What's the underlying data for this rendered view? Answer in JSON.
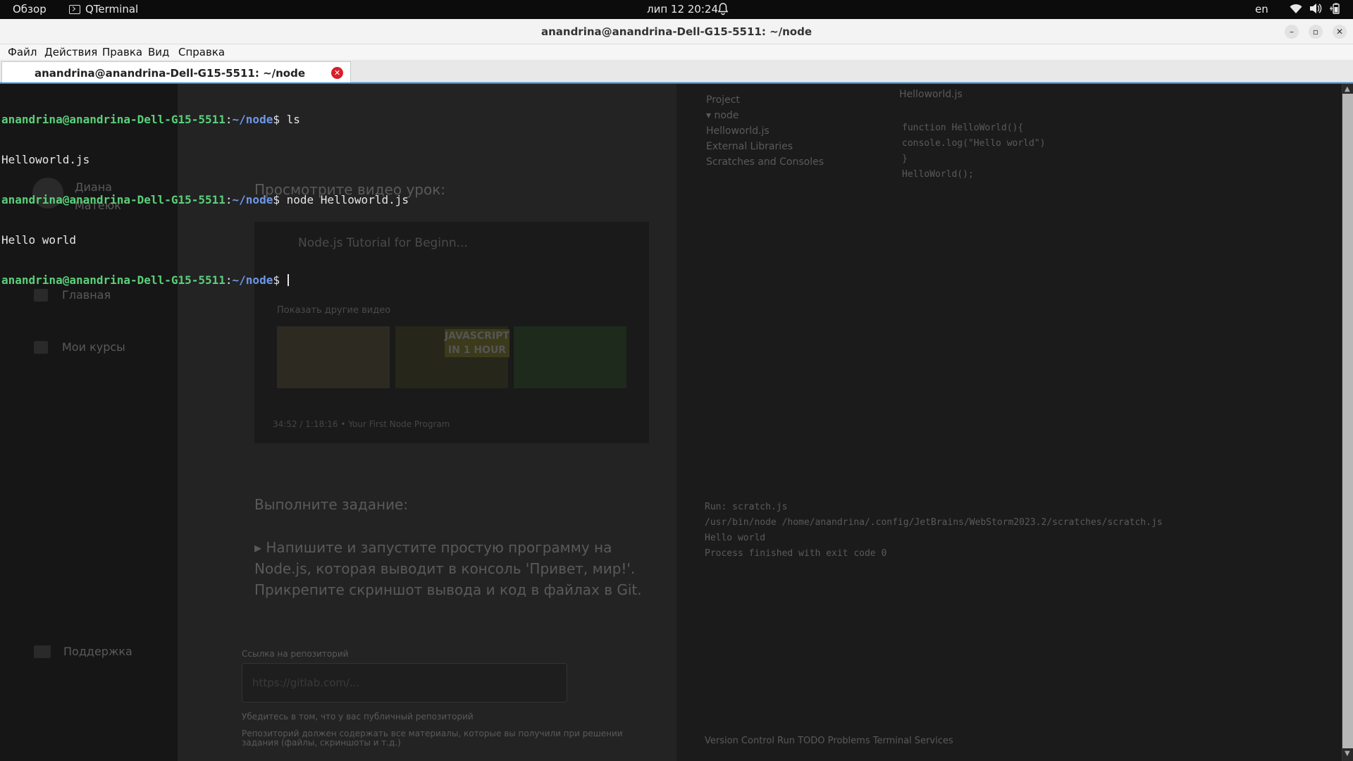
{
  "topbar": {
    "overview": "Обзор",
    "app_name": "QTerminal",
    "clock": "лип 12  20:24",
    "lang": "en"
  },
  "window": {
    "title": "anandrina@anandrina-Dell-G15-5511: ~/node"
  },
  "menu": [
    "Файл",
    "Действия",
    "Правка",
    "Вид",
    "Справка"
  ],
  "tab": {
    "label": "anandrina@anandrina-Dell-G15-5511: ~/node"
  },
  "terminal": {
    "lines": [
      {
        "kind": "prompt",
        "user": "anandrina@anandrina-Dell-G15-5511",
        "path": "~/node",
        "cmd": "ls"
      },
      {
        "kind": "output",
        "text": "Helloworld.js"
      },
      {
        "kind": "prompt",
        "user": "anandrina@anandrina-Dell-G15-5511",
        "path": "~/node",
        "cmd": "node Helloworld.js"
      },
      {
        "kind": "output",
        "text": "Hello world"
      },
      {
        "kind": "prompt",
        "user": "anandrina@anandrina-Dell-G15-5511",
        "path": "~/node",
        "cmd": ""
      }
    ]
  },
  "background": {
    "user_name_1": "Диана",
    "user_name_2": "Матеюк",
    "nav_home": "Главная",
    "nav_courses": "Мои курсы",
    "nav_support": "Поддержка",
    "heading_video": "Просмотрите видео урок:",
    "video_title": "Node.js Tutorial for Beginn...",
    "video_more": "Показать другие видео",
    "video_js_thumb": "JAVASCRIPT IN 1 HOUR",
    "video_bar": "34:52 / 1:18:16 • Your First Node Program",
    "heading_task": "Выполните задание:",
    "task_text": "▸ Напишите и запустите простую программу на Node.js, которая выводит в консоль 'Привет, мир!'. Прикрепите скриншот вывода и код в файлах в Git.",
    "repo_label": "Ссылка на репозиторий",
    "repo_placeholder": "https://gitlab.com/...",
    "repo_hint": "Убедитесь в том, что у вас публичный репозиторий",
    "repo_note": "Репозиторий должен содержать все материалы, которые вы получили при решении задания (файлы, скриншоты и т.д.)",
    "ide_project": [
      "Project",
      "▾ node",
      "   Helloworld.js",
      "  External Libraries",
      "  Scratches and Consoles"
    ],
    "ide_tab": "Helloworld.js",
    "ide_code": [
      "function HelloWorld(){",
      "    console.log(\"Hello world\")",
      "}",
      "",
      "HelloWorld();"
    ],
    "ide_run": [
      "Run:   scratch.js",
      "/usr/bin/node /home/anandrina/.config/JetBrains/WebStorm2023.2/scratches/scratch.js",
      "Hello world",
      "",
      "Process finished with exit code 0"
    ],
    "ide_status": "Version Control   Run   TODO   Problems   Terminal   Services"
  }
}
